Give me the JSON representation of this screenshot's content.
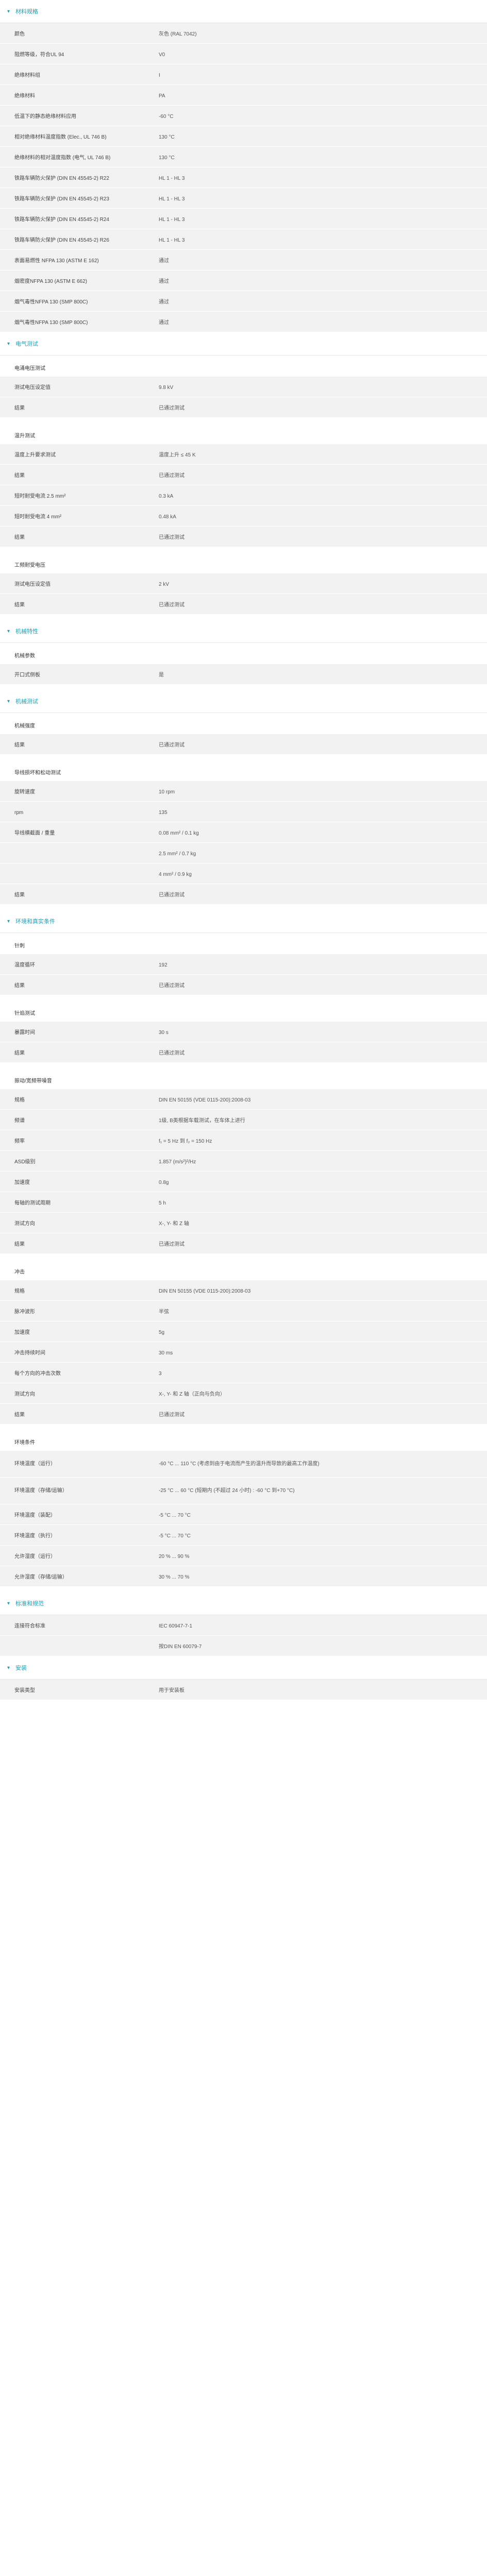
{
  "sections": [
    {
      "title": "材料规格",
      "rows": [
        {
          "label": "颜色",
          "value": "灰色 (RAL 7042)"
        },
        {
          "label": "阻燃等级，符合UL 94",
          "value": "V0"
        },
        {
          "label": "绝缘材料组",
          "value": "I"
        },
        {
          "label": "绝缘材料",
          "value": "PA"
        },
        {
          "label": "低温下的静态绝缘材料应用",
          "value": "-60 °C"
        },
        {
          "label": "相对绝缘材料温度指数 (Elec., UL 746 B)",
          "value": "130 °C"
        },
        {
          "label": "绝缘材料的相对温度指数 (电气, UL 746 B)",
          "value": "130 °C"
        },
        {
          "label": "铁路车辆防火保护 (DIN EN 45545-2) R22",
          "value": "HL 1 - HL 3"
        },
        {
          "label": "铁路车辆防火保护 (DIN EN 45545-2) R23",
          "value": "HL 1 - HL 3"
        },
        {
          "label": "铁路车辆防火保护 (DIN EN 45545-2) R24",
          "value": "HL 1 - HL 3"
        },
        {
          "label": "铁路车辆防火保护 (DIN EN 45545-2) R26",
          "value": "HL 1 - HL 3"
        },
        {
          "label": "表面易燃性 NFPA 130 (ASTM E 162)",
          "value": "通过"
        },
        {
          "label": "烟密度NFPA 130 (ASTM E 662)",
          "value": "通过"
        },
        {
          "label": "烟气毒性NFPA 130 (SMP 800C)",
          "value": "通过"
        },
        {
          "label": "烟气毒性NFPA 130 (SMP 800C)",
          "value": "通过"
        }
      ]
    },
    {
      "title": "电气测试",
      "groups": [
        {
          "sub": "电涌电压测试",
          "rows": [
            {
              "label": "测试电压设定值",
              "value": "9.8 kV"
            },
            {
              "label": "结果",
              "value": "已通过测试"
            }
          ]
        },
        {
          "sub": "温升测试",
          "rows": [
            {
              "label": "温度上升要求测试",
              "value": "温度上升 ≤ 45 K"
            },
            {
              "label": "结果",
              "value": "已通过测试"
            },
            {
              "label": "短时耐受电流 2.5 mm²",
              "value": "0.3 kA"
            },
            {
              "label": "短时耐受电流 4 mm²",
              "value": "0.48 kA"
            },
            {
              "label": "结果",
              "value": "已通过测试"
            }
          ]
        },
        {
          "sub": "工频耐受电压",
          "rows": [
            {
              "label": "测试电压设定值",
              "value": "2 kV"
            },
            {
              "label": "结果",
              "value": "已通过测试"
            }
          ]
        }
      ]
    },
    {
      "title": "机械特性",
      "groups": [
        {
          "sub": "机械参数",
          "rows": [
            {
              "label": "开口式侧板",
              "value": "是"
            }
          ]
        }
      ]
    },
    {
      "title": "机械测试",
      "groups": [
        {
          "sub": "机械强度",
          "rows": [
            {
              "label": "结果",
              "value": "已通过测试"
            }
          ]
        },
        {
          "sub": "导线损坏和松动测试",
          "rows": [
            {
              "label": "旋转速度",
              "value": "10 rpm"
            },
            {
              "label": "rpm",
              "value": "135"
            },
            {
              "label": "导线横截面 / 重量",
              "value": "0.08 mm² / 0.1 kg"
            },
            {
              "label": "",
              "value": "2.5 mm² / 0.7 kg"
            },
            {
              "label": "",
              "value": "4 mm² / 0.9 kg"
            },
            {
              "label": "结果",
              "value": "已通过测试"
            }
          ]
        }
      ]
    },
    {
      "title": "环境和真实条件",
      "groups": [
        {
          "sub": "针刺",
          "rows": [
            {
              "label": "温度循环",
              "value": "192"
            },
            {
              "label": "结果",
              "value": "已通过测试"
            }
          ]
        },
        {
          "sub": "针焰测试",
          "rows": [
            {
              "label": "暴露时间",
              "value": "30 s"
            },
            {
              "label": "结果",
              "value": "已通过测试"
            }
          ]
        },
        {
          "sub": "振动/宽频带噪音",
          "rows": [
            {
              "label": "规格",
              "value": "DIN EN 50155 (VDE 0115-200):2008-03"
            },
            {
              "label": "频谱",
              "value": "1级, B类根据车载测试，在车体上进行"
            },
            {
              "label": "频率",
              "value": "f₁ = 5 Hz 到 f₂ = 150 Hz"
            },
            {
              "label": "ASD级别",
              "value": "1.857 (m/s²)²/Hz"
            },
            {
              "label": "加速度",
              "value": "0.8g"
            },
            {
              "label": "每轴的测试周期",
              "value": "5 h"
            },
            {
              "label": "测试方向",
              "value": "X-, Y- 和 Z 轴"
            },
            {
              "label": "结果",
              "value": "已通过测试"
            }
          ]
        },
        {
          "sub": "冲击",
          "rows": [
            {
              "label": "规格",
              "value": "DIN EN 50155 (VDE 0115-200):2008-03"
            },
            {
              "label": "脉冲波形",
              "value": "半弦"
            },
            {
              "label": "加速度",
              "value": "5g"
            },
            {
              "label": "冲击持续时间",
              "value": "30 ms"
            },
            {
              "label": "每个方向的冲击次数",
              "value": "3"
            },
            {
              "label": "测试方向",
              "value": "X-, Y- 和 Z 轴（正向与负向）"
            },
            {
              "label": "结果",
              "value": "已通过测试"
            }
          ]
        },
        {
          "sub": "环境条件",
          "rows": [
            {
              "label": "环境温度（运行）",
              "value": "-60 °C ... 110 °C (考虑到由于电流而产生的温升而导致的最高工作温度)"
            },
            {
              "label": "环境温度（存储/运输）",
              "value": "-25 °C ... 60 °C (短期内 (不超过 24 小时) : -60 °C 到+70 °C)"
            },
            {
              "label": "环境温度（装配）",
              "value": "-5 °C ... 70 °C"
            },
            {
              "label": "环境温度（执行）",
              "value": "-5 °C ... 70 °C"
            },
            {
              "label": "允许湿度（运行）",
              "value": "20 % ... 90 %"
            },
            {
              "label": "允许湿度（存储/运输）",
              "value": "30 % ... 70 %"
            }
          ]
        }
      ]
    },
    {
      "title": "标准和规范",
      "rows": [
        {
          "label": "连接符合标准",
          "value": "IEC 60947-7-1"
        },
        {
          "label": "",
          "value": "按DIN EN 60079-7"
        }
      ]
    },
    {
      "title": "安装",
      "rows": [
        {
          "label": "安装类型",
          "value": "用于安装板"
        }
      ]
    }
  ]
}
